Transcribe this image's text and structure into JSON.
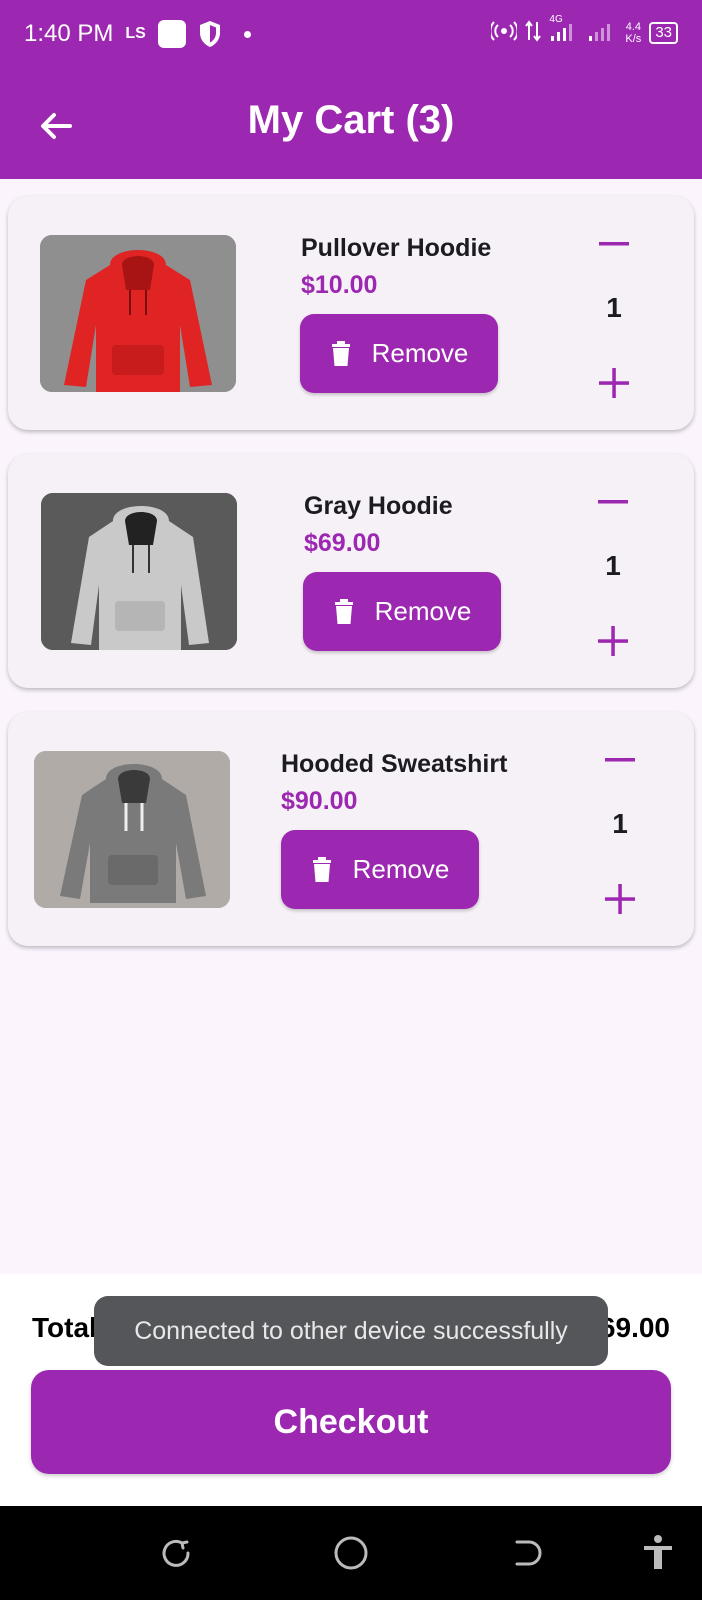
{
  "status_bar": {
    "time": "1:40 PM",
    "carrier_badge": "LS",
    "network": "4G",
    "speed_value": "4.4",
    "speed_unit": "K/s",
    "battery": "33"
  },
  "app_bar": {
    "title": "My Cart (3)"
  },
  "cart_items": [
    {
      "name": "Pullover Hoodie",
      "price": "$10.00",
      "remove_label": "Remove",
      "quantity": "1",
      "image_color": "#e02424"
    },
    {
      "name": "Gray Hoodie",
      "price": "$69.00",
      "remove_label": "Remove",
      "quantity": "1",
      "image_color": "#c9c9c9"
    },
    {
      "name": "Hooded Sweatshirt",
      "price": "$90.00",
      "remove_label": "Remove",
      "quantity": "1",
      "image_color": "#7a7a7a"
    }
  ],
  "summary": {
    "total_items": "Total Items: 3",
    "total_price": "Total: $169.00",
    "checkout_label": "Checkout"
  },
  "toast": {
    "message": "Connected to other device successfully"
  },
  "colors": {
    "primary": "#9c27b0",
    "background": "#fbf4fd",
    "card": "#f6f0f7"
  }
}
